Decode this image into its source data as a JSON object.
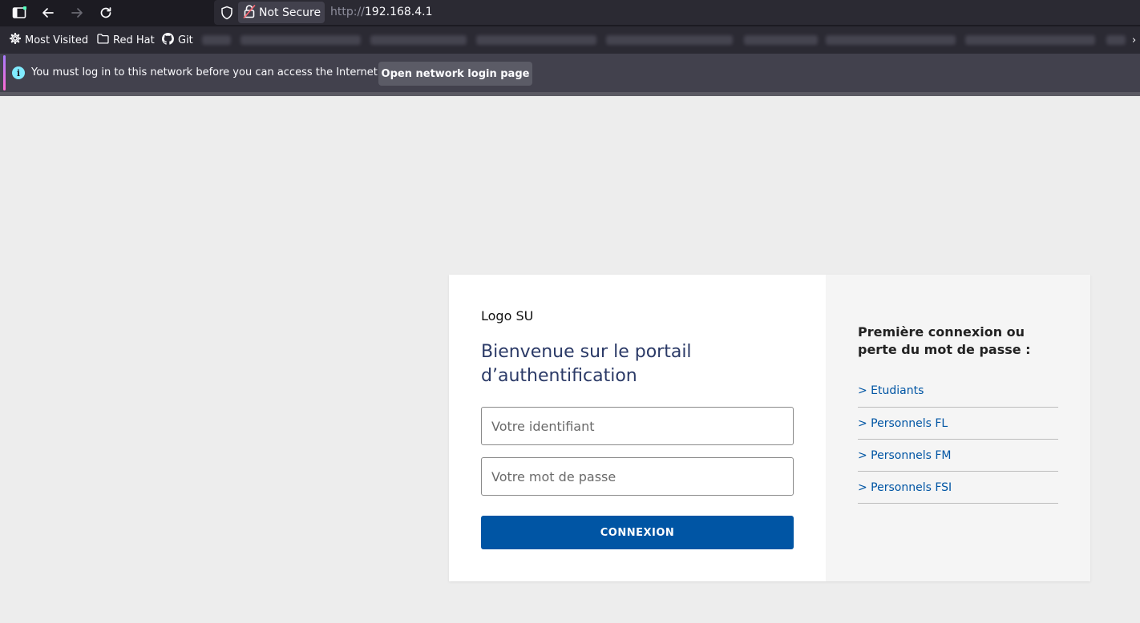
{
  "browser": {
    "security_label": "Not Secure",
    "url_scheme": "http://",
    "url_host": "192.168.4.1",
    "bookmarks": [
      {
        "label": "Most Visited",
        "icon": "gear-icon"
      },
      {
        "label": "Red Hat",
        "icon": "folder-icon"
      },
      {
        "label": "Git",
        "icon": "github-icon"
      }
    ],
    "notice": {
      "text": "You must log in to this network before you can access the Internet.",
      "button_label": "Open network login page"
    }
  },
  "login": {
    "logo_text": "Logo SU",
    "heading": "Bienvenue sur le portail d’authentification",
    "username_placeholder": "Votre identifiant",
    "password_placeholder": "Votre mot de passe",
    "submit_label": "CONNEXION"
  },
  "sidebar": {
    "title": "Première connexion ou perte du mot de passe :",
    "links": [
      {
        "label": "> Etudiants"
      },
      {
        "label": "> Personnels FL"
      },
      {
        "label": "> Personnels FM"
      },
      {
        "label": "> Personnels FSI"
      }
    ]
  },
  "colors": {
    "primary": "#0055a4",
    "heading": "#2b3a67",
    "page_background": "#ededed"
  }
}
